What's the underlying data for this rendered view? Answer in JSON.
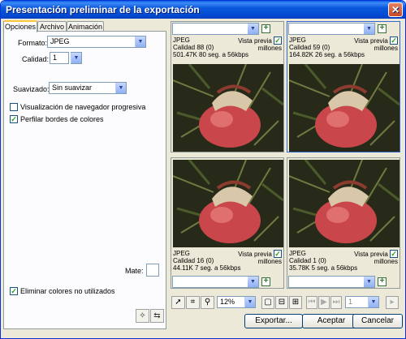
{
  "window": {
    "title": "Presentación preliminar de la exportación",
    "close_glyph": "✕"
  },
  "tabs": [
    {
      "label": "Opciones"
    },
    {
      "label": "Archivo"
    },
    {
      "label": "Animación"
    }
  ],
  "options": {
    "format_label": "Formato:",
    "format_value": "JPEG",
    "quality_label": "Calidad:",
    "quality_value": "1",
    "smoothing_label": "Suavizado:",
    "smoothing_value": "Sin suavizar",
    "progressive_label": "Visualización de navegador progresiva",
    "progressive_checked": false,
    "sharpen_label": "Perfilar bordes de colores",
    "sharpen_checked": true,
    "matte_label": "Mate:",
    "remove_unused_label": "Eliminar colores no utilizados",
    "remove_unused_checked": true
  },
  "previews": [
    {
      "format": "JPEG",
      "vista": "Vista previa",
      "millones": "millones",
      "quality": "Calidad 88 (0)",
      "size": "501.47K  80 seg. a 56kbps"
    },
    {
      "format": "JPEG",
      "vista": "Vista previa",
      "millones": "millones",
      "quality": "Calidad 59 (0)",
      "size": "164.82K  26 seg. a 56kbps"
    },
    {
      "format": "JPEG",
      "vista": "Vista previa",
      "millones": "millones",
      "quality": "Calidad 16 (0)",
      "size": "44.11K  7 seg. a 56kbps"
    },
    {
      "format": "JPEG",
      "vista": "Vista previa",
      "millones": "millones",
      "quality": "Calidad 1 (0)",
      "size": "35.78K  5 seg. a 56kbps"
    }
  ],
  "toolbar": {
    "zoom_value": "12%",
    "frame_value": "1"
  },
  "buttons": {
    "export": "Exportar...",
    "accept": "Aceptar",
    "cancel": "Cancelar"
  },
  "icons": {
    "pointer": "pointer-icon",
    "crop": "crop-icon",
    "zoom": "magnifier-icon",
    "single_view": "single-view-icon",
    "split_view": "split-view-icon",
    "quad_view": "quad-view-icon"
  }
}
